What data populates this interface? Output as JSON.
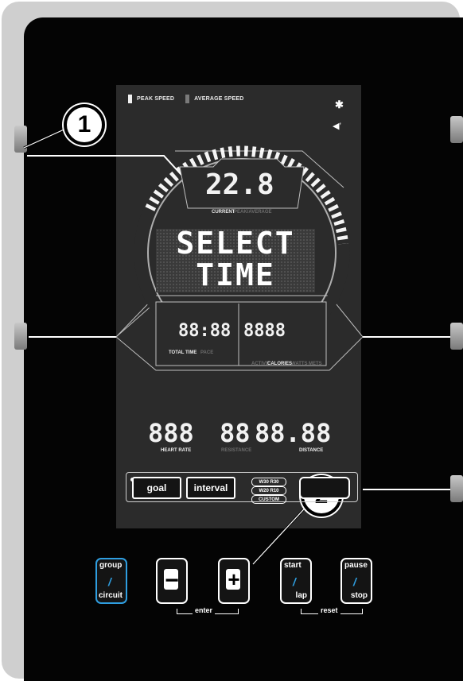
{
  "callouts": {
    "one": "1",
    "two": "2"
  },
  "legend": {
    "peak_speed": "PEAK SPEED",
    "average_speed": "AVERAGE SPEED"
  },
  "status_icons": {
    "bluetooth": "bluetooth-icon",
    "volume": "volume-icon"
  },
  "speed_display": {
    "value": "22.8",
    "label_current": "CURRENT",
    "label_peak_avg": "PEAK/AVERAGE"
  },
  "message": {
    "line1": "SELECT",
    "line2": "TIME"
  },
  "left_readout": {
    "value": "88:88",
    "label_total_time": "TOTAL TIME",
    "label_pace": "PACE"
  },
  "right_readout": {
    "value": "8888",
    "label_active": "ACTIVE",
    "label_calories": "CALORIES",
    "label_watts": "WATTS",
    "label_mets": "METS"
  },
  "lower_readouts": {
    "heart_rate_value": "888",
    "heart_rate_label": "HEART RATE",
    "resistance_value": "88",
    "resistance_label": "RESISTANCE",
    "distance_value": "88.88",
    "distance_label": "DISTANCE"
  },
  "modes": {
    "goal": "goal",
    "interval": "interval",
    "presets": [
      "W30 R30",
      "W20 R10",
      "CUSTOM"
    ]
  },
  "keys": {
    "group_top": "group",
    "group_bottom": "circuit",
    "minus": "−",
    "plus": "+",
    "start_top": "start",
    "start_bottom": "lap",
    "pause_top": "pause",
    "pause_bottom": "stop",
    "enter": "enter",
    "reset": "reset"
  },
  "colors": {
    "accent_blue": "#2f9ee0",
    "panel": "#040404",
    "screen": "#2b2b2b"
  }
}
